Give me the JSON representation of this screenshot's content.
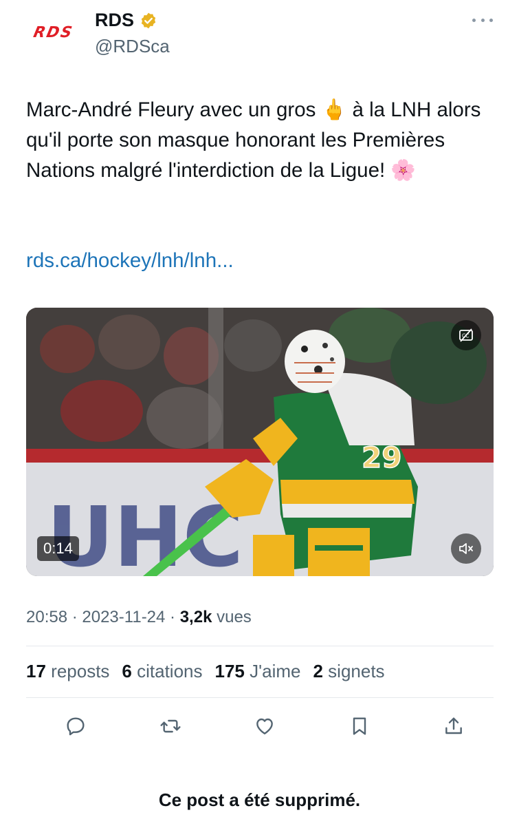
{
  "author": {
    "logo_text": "RDS",
    "display_name": "RDS",
    "handle": "@RDSca",
    "verified_icon": "verified-gold-badge-icon"
  },
  "more_icon": "more-horizontal-icon",
  "post": {
    "text": "Marc-André Fleury avec un gros 🖕 à la LNH alors qu'il porte son masque honorant les Premières Nations malgré l'interdiction de la Ligue! 🌸",
    "link": "rds.ca/hockey/lnh/lnh..."
  },
  "media": {
    "type": "video",
    "duration": "0:14",
    "jersey_number": "29",
    "board_letters": "UHC",
    "cc_icon": "captions-off-icon",
    "mute_icon": "speaker-muted-icon"
  },
  "meta": {
    "time": "20:58",
    "separator": " · ",
    "date": "2023-11-24",
    "views_count": "3,2k",
    "views_label": "vues"
  },
  "stats": [
    {
      "count": "17",
      "label": "reposts"
    },
    {
      "count": "6",
      "label": "citations"
    },
    {
      "count": "175",
      "label": "J'aime"
    },
    {
      "count": "2",
      "label": "signets"
    }
  ],
  "actions": [
    "reply-icon",
    "repost-icon",
    "like-icon",
    "bookmark-icon",
    "share-icon"
  ],
  "footer": {
    "deleted_notice": "Ce post a été supprimé."
  },
  "colors": {
    "link": "#1d74b8",
    "secondary_text": "#536471",
    "brand_red": "#e01e26",
    "verified_gold": "#e8b322",
    "jersey_green": "#1f7a3c",
    "jersey_gold": "#f0b51e"
  }
}
